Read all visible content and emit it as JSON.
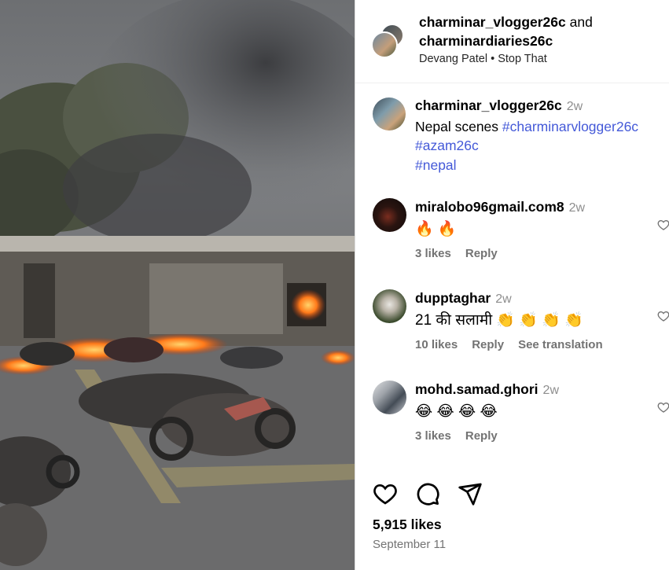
{
  "post": {
    "header": {
      "user1": "charminar_vlogger26c",
      "joiner": "and",
      "user2": "charminardiaries26c",
      "audio_artist": "Devang Patel",
      "audio_sep": "•",
      "audio_track": "Stop That"
    },
    "caption": {
      "username": "charminar_vlogger26c",
      "time": "2w",
      "text": "Nepal scenes ",
      "tags": [
        "#charminarvlogger26c",
        "#azam26c",
        "#nepal"
      ]
    },
    "comments": [
      {
        "username": "miralobo96gmail.com8",
        "time": "2w",
        "text": "🔥 🔥",
        "likes": "3 likes",
        "reply": "Reply",
        "translate": ""
      },
      {
        "username": "dupptaghar",
        "time": "2w",
        "text": "21 की सलामी 👏 👏 👏 👏",
        "likes": "10 likes",
        "reply": "Reply",
        "translate": "See translation"
      },
      {
        "username": "mohd.samad.ghori",
        "time": "2w",
        "text": "😂 😂 😂 😂",
        "likes": "3 likes",
        "reply": "Reply",
        "translate": ""
      }
    ],
    "likes_count": "5,915 likes",
    "date": "September 11"
  },
  "icons": [
    "like-icon",
    "comment-icon",
    "share-icon",
    "comment-like-icon"
  ],
  "colors": {
    "hashtag": "#4459d8",
    "muted": "#737373",
    "border": "#dbdbdb"
  }
}
